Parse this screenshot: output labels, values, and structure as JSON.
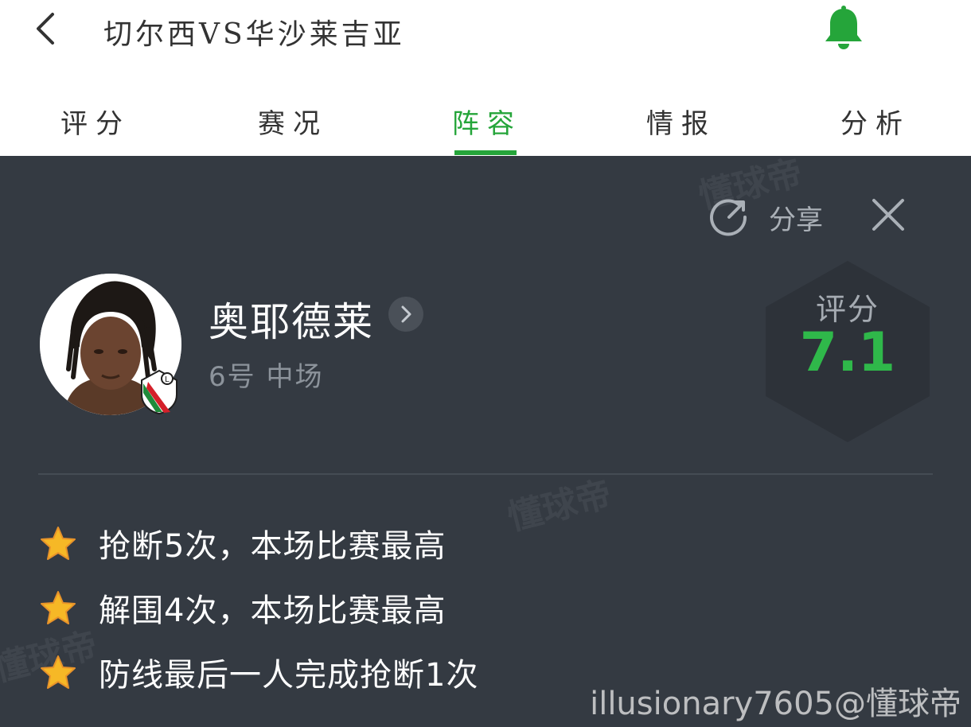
{
  "header": {
    "title": "切尔西VS华沙莱吉亚",
    "back_icon": "chevron-left-icon",
    "bell_icon": "bell-icon"
  },
  "tabs": [
    {
      "label": "评分"
    },
    {
      "label": "赛况"
    },
    {
      "label": "阵容",
      "active": true
    },
    {
      "label": "情报"
    },
    {
      "label": "分析"
    }
  ],
  "colors": {
    "accent_green": "#25a53a",
    "panel_bg": "#343a42"
  },
  "panel": {
    "share_label": "分享",
    "share_icon": "share-icon",
    "close_icon": "close-icon"
  },
  "player": {
    "name": "奥耶德莱",
    "meta": "6号 中场",
    "rating_label": "评分",
    "rating_value": "7.1"
  },
  "highlights": [
    {
      "text": "抢断5次，本场比赛最高"
    },
    {
      "text": "解围4次，本场比赛最高"
    },
    {
      "text": "防线最后一人完成抢断1次"
    }
  ],
  "watermarks": [
    "懂球帝",
    "懂球帝",
    "懂球帝"
  ],
  "signature": "illusionary7605@懂球帝"
}
